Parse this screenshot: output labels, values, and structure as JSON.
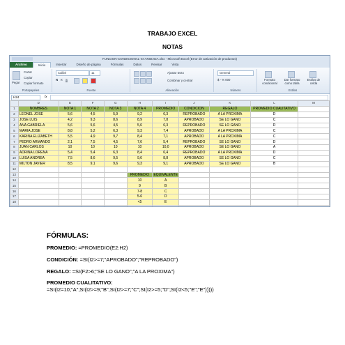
{
  "page": {
    "title": "TRABAJO EXCEL",
    "subtitle": "NOTAS"
  },
  "excel": {
    "window_title": "FUNCION-CONDICIONAL-SI-ANIDADA.xlsx - Microsoft Excel (Error de activación de productos)",
    "tabs": [
      "Archivo",
      "Inicio",
      "Insertar",
      "Diseño de página",
      "Fórmulas",
      "Datos",
      "Revisar",
      "Vista"
    ],
    "ribbon": {
      "paste": "Pegar",
      "cut": "Cortar",
      "copy": "Copiar",
      "format_painter": "Copiar formato",
      "font_name": "Calibri",
      "font_size": "11",
      "wrap_text": "Ajustar texto",
      "merge_center": "Combinar y centrar",
      "number_format": "General",
      "conditional_format": "Formato condicional",
      "format_as_table": "Dar formato como tabla",
      "cell_styles": "Estilos de celda",
      "groups": [
        "Portapapeles",
        "Fuente",
        "Alineación",
        "Número",
        "Estilos"
      ]
    },
    "name_box": "H24",
    "fx": "fx",
    "columns": [
      "D",
      "E",
      "F",
      "G",
      "H",
      "I",
      "J",
      "K",
      "L",
      "M"
    ],
    "selected_column": "H",
    "rows": [
      "1",
      "2",
      "3",
      "4",
      "5",
      "6",
      "7",
      "8",
      "9",
      "10",
      "11",
      "12",
      "13",
      "14",
      "15",
      "16",
      "17",
      "18",
      "19",
      "20"
    ],
    "headers": [
      "NOMBRES",
      "NOTA 1",
      "NOTA 2",
      "NOTA 3",
      "NOTA 4",
      "PROMEDIO",
      "CONDICIÓN",
      "REGALO",
      "PROMEDIO CUALITATIVO"
    ],
    "students": [
      [
        "LEONEL JOSE",
        "5,6",
        "4,5",
        "5,9",
        "9,2",
        "6,3",
        "REPROBADO",
        "A LA PROXIMA",
        "D"
      ],
      [
        "JOSE LUIS",
        "4,2",
        "9,3",
        "8,6",
        "8,9",
        "7,8",
        "APROBADO",
        "SE LO GANO",
        "C"
      ],
      [
        "ANA GABRIELA",
        "5,6",
        "5,6",
        "4,5",
        "5,6",
        "6,3",
        "REPROBADO",
        "SE LO GANO",
        "D"
      ],
      [
        "MARIA JOSE",
        "8,8",
        "5,2",
        "6,3",
        "9,3",
        "7,4",
        "APROBADO",
        "A LA PROXIMA",
        "C"
      ],
      [
        "KARINA ELIZABETH",
        "5,5",
        "4,9",
        "9,7",
        "8,4",
        "7,1",
        "APROBADO",
        "A LA PROXIMA",
        "C"
      ],
      [
        "PEDRO ARMANDO",
        "2,1",
        "7,5",
        "4,5",
        "7,6",
        "5,4",
        "REPROBADO",
        "SE LO GANO",
        "D"
      ],
      [
        "JUAN CARLOS",
        "10",
        "10",
        "10",
        "10",
        "10,0",
        "APROBADO",
        "SE LO GANO",
        "A"
      ],
      [
        "ADRINA LORENA",
        "5,4",
        "5,4",
        "6,3",
        "8,4",
        "6,4",
        "REPROBADO",
        "A LA PROXIMA",
        "D"
      ],
      [
        "LUISA ANDREA",
        "7,5",
        "8,6",
        "9,5",
        "9,6",
        "8,8",
        "APROBADO",
        "SE LO GANO",
        "C"
      ],
      [
        "MILTON JAVIER",
        "8,5",
        "9,1",
        "9,6",
        "9,3",
        "9,1",
        "APROBADO",
        "SE LO GANO",
        "B"
      ]
    ],
    "legend": {
      "headers": [
        "PROMEDIO",
        "EQUIVALENTE"
      ],
      "rows": [
        [
          "10",
          "A"
        ],
        [
          "9",
          "B"
        ],
        [
          "7-8",
          "C"
        ],
        [
          "5-6",
          "D"
        ],
        [
          "<5",
          "E"
        ]
      ]
    }
  },
  "formulas": {
    "heading": "FÓRMULAS:",
    "promedio_label": "PROMEDIO:",
    "promedio": " =PROMEDIO(E2:H2)",
    "condicion_label": "CONDICIÓN:",
    "condicion": " =SI(I2>=7;\"APROBADO\";\"REPROBADO\")",
    "regalo_label": "REGALO:",
    "regalo": " =SI(F2>6;\"SE  LO GANO\";\"A LA PROXIMA\")",
    "cualitativo_label": "PROMEDIO CUALITATIVO:",
    "cualitativo": "=SI(I2=10;\"A\";SI(I2>=9;\"B\";SI(I2>=7;\"C\";SI(I2>=5;\"D\";SI(I2<5;\"E\";\"E\")))))"
  }
}
